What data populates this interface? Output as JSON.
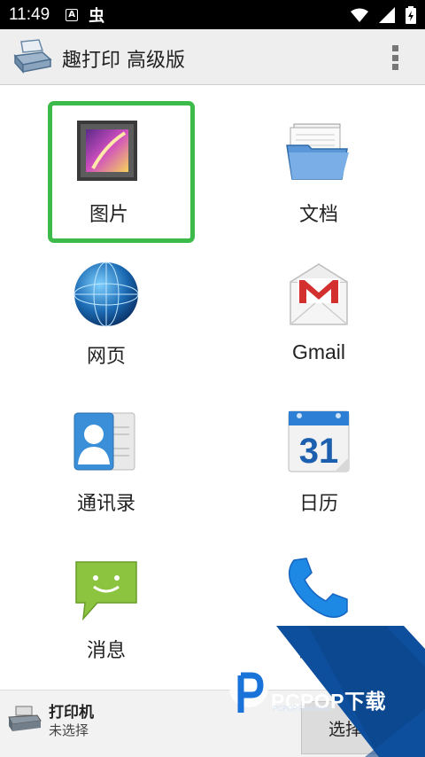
{
  "status_bar": {
    "time": "11:49",
    "notif_a": "A",
    "notif_bug": "虫"
  },
  "app_bar": {
    "title": "趣打印 高级版"
  },
  "grid": {
    "items": [
      {
        "label": "图片",
        "icon": "picture-icon",
        "selected": true
      },
      {
        "label": "文档",
        "icon": "folder-icon",
        "selected": false
      },
      {
        "label": "网页",
        "icon": "globe-icon",
        "selected": false
      },
      {
        "label": "Gmail",
        "icon": "gmail-icon",
        "selected": false
      },
      {
        "label": "通讯录",
        "icon": "contacts-icon",
        "selected": false
      },
      {
        "label": "日历",
        "icon": "calendar-icon",
        "selected": false,
        "day": "31"
      },
      {
        "label": "消息",
        "icon": "message-icon",
        "selected": false
      },
      {
        "label": "通话",
        "icon": "phone-icon",
        "selected": false
      }
    ]
  },
  "bottom_bar": {
    "printer_title": "打印机",
    "printer_status": "未选择",
    "select_label": "选择"
  },
  "watermark": {
    "brand": "PCPOP下载",
    "sub": "PCPOP Download"
  },
  "colors": {
    "selection": "#3dbb4a",
    "watermark_blue": "#0d4f9c",
    "gmail_red": "#d32f2f"
  }
}
